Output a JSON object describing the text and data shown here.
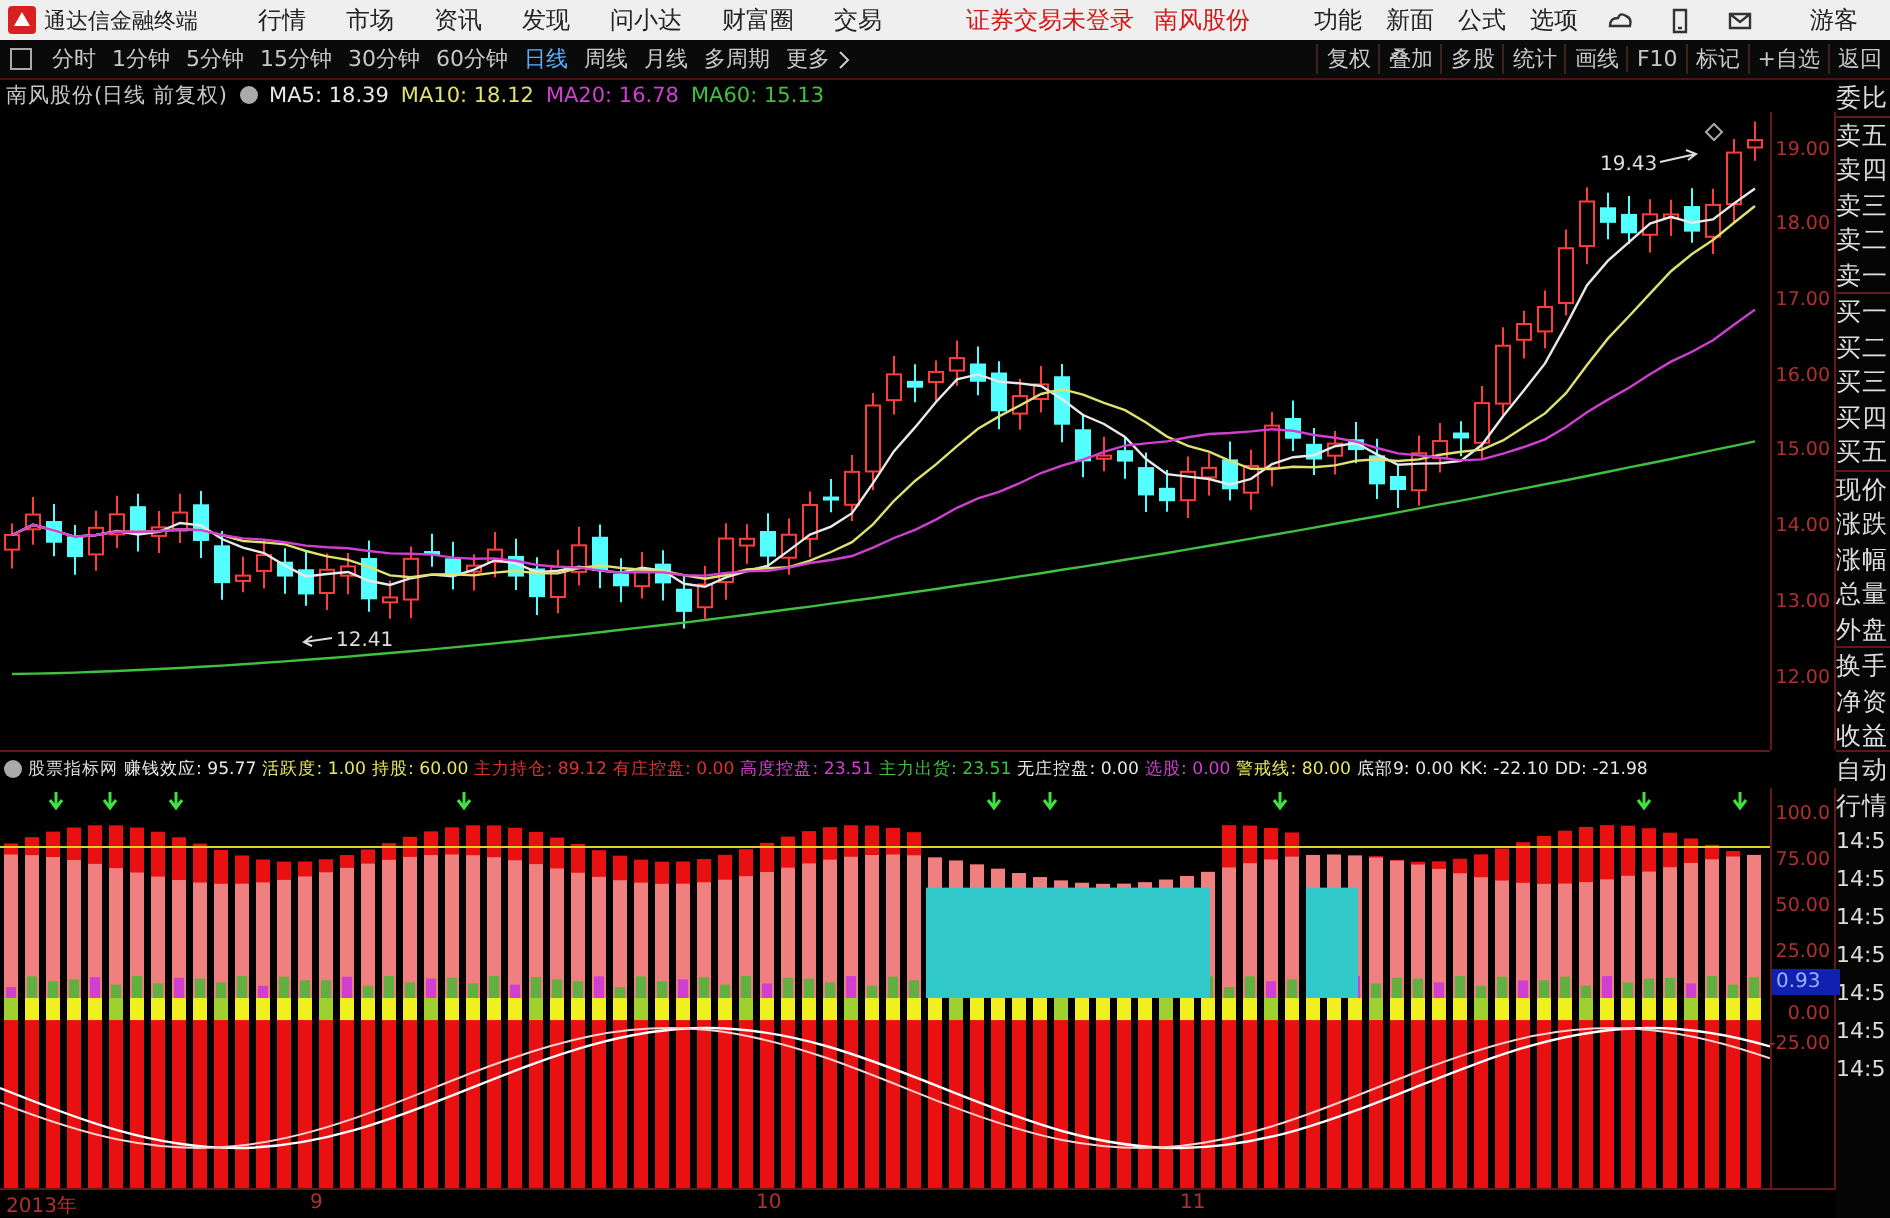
{
  "app": {
    "title": "通达信金融终端",
    "menu": [
      "行情",
      "市场",
      "资讯",
      "发现",
      "问小达",
      "财富圈",
      "交易"
    ],
    "notice": "证券交易未登录",
    "stock_name": "南风股份",
    "tools": [
      "功能",
      "新面",
      "公式",
      "选项"
    ],
    "guest": "游客"
  },
  "periods": [
    {
      "label": "分时",
      "selected": false
    },
    {
      "label": "1分钟",
      "selected": false
    },
    {
      "label": "5分钟",
      "selected": false
    },
    {
      "label": "15分钟",
      "selected": false
    },
    {
      "label": "30分钟",
      "selected": false
    },
    {
      "label": "60分钟",
      "selected": false
    },
    {
      "label": "日线",
      "selected": true
    },
    {
      "label": "周线",
      "selected": false
    },
    {
      "label": "月线",
      "selected": false
    },
    {
      "label": "多周期",
      "selected": false
    },
    {
      "label": "更多",
      "selected": false
    }
  ],
  "actions": [
    "复权",
    "叠加",
    "多股",
    "统计",
    "画线",
    "F10",
    "标记",
    "+自选",
    "返回"
  ],
  "main_chart": {
    "title": "南风股份(日线 前复权)",
    "ma": [
      {
        "label": "MA5: 18.39",
        "color": "#e8e8e8"
      },
      {
        "label": "MA10: 18.12",
        "color": "#e0e070"
      },
      {
        "label": "MA20: 16.78",
        "color": "#d040d0"
      },
      {
        "label": "MA60: 15.13",
        "color": "#40c040"
      }
    ],
    "high_label": "19.43",
    "low_label": "12.41",
    "price_ticks": [
      "19.00",
      "18.00",
      "17.00",
      "16.00",
      "15.00",
      "14.00",
      "13.00",
      "12.00"
    ]
  },
  "indicator": {
    "name": "股票指标网",
    "items": [
      {
        "label": "赚钱效应:",
        "value": "95.77",
        "color": "#e8e8e8"
      },
      {
        "label": "活跃度:",
        "value": "1.00",
        "color": "#e8e860"
      },
      {
        "label": "持股:",
        "value": "60.00",
        "color": "#e8e860"
      },
      {
        "label": "主力持仓:",
        "value": "89.12",
        "color": "#e03030"
      },
      {
        "label": "有庄控盘:",
        "value": "0.00",
        "color": "#e03030"
      },
      {
        "label": "高度控盘:",
        "value": "23.51",
        "color": "#d040d0"
      },
      {
        "label": "主力出货:",
        "value": "23.51",
        "color": "#40c040"
      },
      {
        "label": "无庄控盘:",
        "value": "0.00",
        "color": "#e8e8e8"
      },
      {
        "label": "选股:",
        "value": "0.00",
        "color": "#d040d0"
      },
      {
        "label": "警戒线:",
        "value": "80.00",
        "color": "#e8e860"
      },
      {
        "label": "底部9:",
        "value": "0.00",
        "color": "#e8e8e8"
      },
      {
        "label": "KK:",
        "value": "-22.10",
        "color": "#e8e8e8"
      },
      {
        "label": "DD:",
        "value": "-21.98",
        "color": "#e8e8e8"
      }
    ],
    "ticks": [
      "100.0",
      "75.00",
      "50.00",
      "25.00",
      "0.00",
      "-25.00"
    ],
    "cursor_value": "0.93"
  },
  "dates": [
    "2013年",
    "9",
    "10",
    "11"
  ],
  "side_panel": {
    "quote_labels": [
      "委比",
      "卖五",
      "卖四",
      "卖三",
      "卖二",
      "卖一",
      "买一",
      "买二",
      "买三",
      "买四",
      "买五",
      "现价",
      "涨跌",
      "涨幅",
      "总量",
      "外盘",
      "换手",
      "净资",
      "收益"
    ],
    "auto": "自动",
    "market": "行情",
    "times": [
      "14:5",
      "14:5",
      "14:5",
      "14:5",
      "14:5",
      "14:5",
      "14:5"
    ]
  }
}
